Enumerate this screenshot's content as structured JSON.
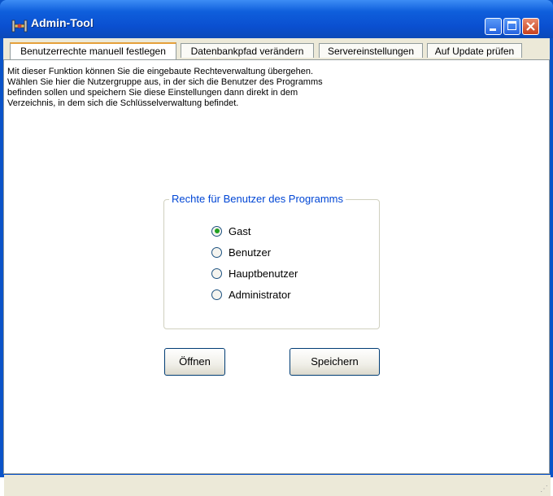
{
  "window": {
    "title": "Admin-Tool"
  },
  "tabs": [
    {
      "label": "Benutzerrechte manuell festlegen",
      "active": true
    },
    {
      "label": "Datenbankpfad verändern",
      "active": false
    },
    {
      "label": "Servereinstellungen",
      "active": false
    },
    {
      "label": "Auf Update prüfen",
      "active": false
    }
  ],
  "panel": {
    "description": "Mit dieser Funktion können Sie die eingebaute Rechteverwaltung übergehen.\nWählen Sie hier die Nutzergruppe aus, in der sich die Benutzer des Programms\nbefinden sollen und speichern Sie diese Einstellungen dann direkt in dem\nVerzeichnis, in dem sich die Schlüsselverwaltung befindet.",
    "group": {
      "title": "Rechte für Benutzer des Programms",
      "options": [
        {
          "label": "Gast",
          "selected": true
        },
        {
          "label": "Benutzer",
          "selected": false
        },
        {
          "label": "Hauptbenutzer",
          "selected": false
        },
        {
          "label": "Administrator",
          "selected": false
        }
      ]
    },
    "buttons": {
      "open": "Öffnen",
      "save": "Speichern"
    }
  },
  "colors": {
    "titlebar": "#0a53c8",
    "group_title": "#0046d5",
    "radio_dot": "#21a121",
    "tab_accent": "#e5a03a",
    "close_button": "#c7401d"
  },
  "icons": [
    "app-icon",
    "minimize-icon",
    "maximize-icon",
    "close-icon",
    "resize-grip-icon"
  ]
}
